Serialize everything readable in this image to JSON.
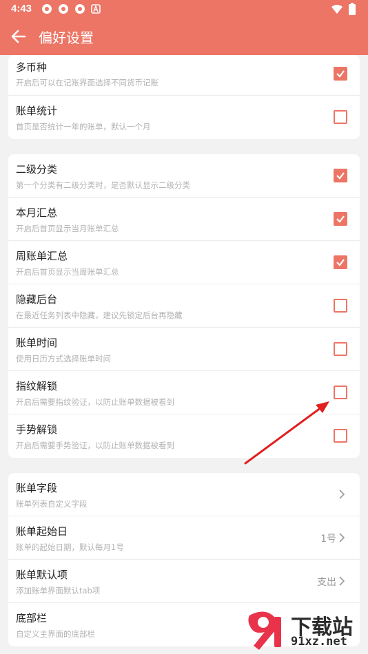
{
  "status_bar": {
    "time": "4:43"
  },
  "app_bar": {
    "title": "偏好设置"
  },
  "section1": [
    {
      "title": "多币种",
      "subtitle": "开启后可以在记账界面选择不同货币记账",
      "checked": true
    },
    {
      "title": "账单统计",
      "subtitle": "首页是否统计一年的账单，默认一个月",
      "checked": false
    }
  ],
  "section2": [
    {
      "title": "二级分类",
      "subtitle": "第一个分类有二级分类时，是否默认显示二级分类",
      "checked": true
    },
    {
      "title": "本月汇总",
      "subtitle": "开启后首页显示当月账单汇总",
      "checked": true
    },
    {
      "title": "周账单汇总",
      "subtitle": "开启后首页显示当周账单汇总",
      "checked": true
    },
    {
      "title": "隐藏后台",
      "subtitle": "在最近任务列表中隐藏，建议先锁定后台再隐藏",
      "checked": false
    },
    {
      "title": "账单时间",
      "subtitle": "使用日历方式选择账单时间",
      "checked": false
    },
    {
      "title": "指纹解锁",
      "subtitle": "开启后需要指纹验证，以防止账单数据被看到",
      "checked": false
    },
    {
      "title": "手势解锁",
      "subtitle": "开启后需要手势验证，以防止账单数据被看到",
      "checked": false
    }
  ],
  "section3": [
    {
      "title": "账单字段",
      "subtitle": "账单列表自定义字段",
      "value": ""
    },
    {
      "title": "账单起始日",
      "subtitle": "账单的起始日期，默认每月1号",
      "value": "1号"
    },
    {
      "title": "账单默认项",
      "subtitle": "添加账单界面默认tab项",
      "value": "支出"
    },
    {
      "title": "底部栏",
      "subtitle": "自定义主界面的底部栏",
      "value": ""
    }
  ],
  "watermark": {
    "word": "下载站",
    "url": "91xz.net"
  },
  "colors": {
    "accent": "#ec7565",
    "annotation_arrow": "#e02020"
  }
}
